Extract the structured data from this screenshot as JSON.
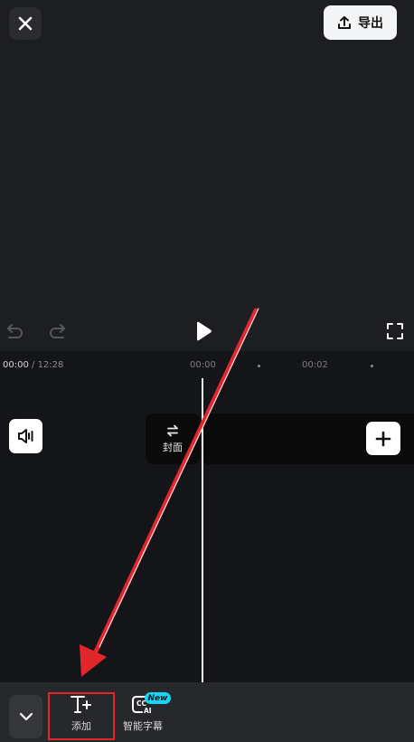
{
  "header": {
    "close_icon": "close-icon",
    "export_label": "导出",
    "export_icon": "upload-icon"
  },
  "player": {
    "undo_icon": "undo-icon",
    "redo_icon": "redo-icon",
    "play_icon": "play-icon",
    "fullscreen_icon": "fullscreen-icon"
  },
  "timeline": {
    "current_time": "00:00",
    "separator": " / ",
    "total_time": "12:28",
    "ticks": [
      "00:00",
      "00:02"
    ],
    "cover_label": "封面",
    "cover_icon": "swap-icon",
    "audio_icon": "speaker-icon",
    "add_clip_icon": "plus-icon"
  },
  "toolbar": {
    "collapse_icon": "chevron-down-icon",
    "tools": [
      {
        "label": "添加",
        "icon": "text-add-icon"
      },
      {
        "label": "智能字幕",
        "icon": "cc-ai-icon",
        "badge": "New"
      }
    ],
    "badge_color": "#19d4f0"
  },
  "annotation": {
    "arrow_color": "#e3262c",
    "highlight_color": "#e3262c"
  }
}
